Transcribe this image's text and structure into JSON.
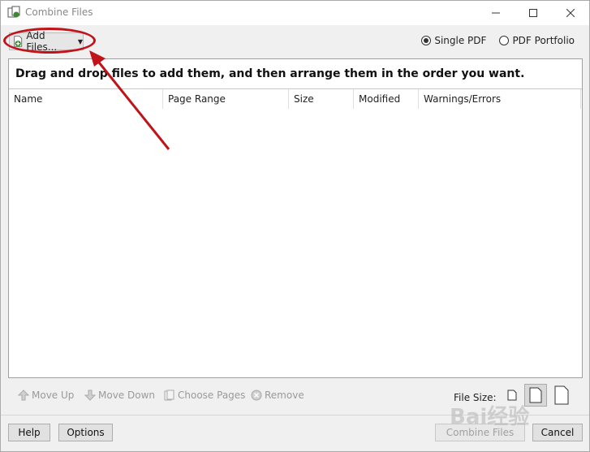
{
  "window": {
    "title": "Combine Files"
  },
  "toolbar": {
    "add_files_label": "Add Files...",
    "radio_single": "Single PDF",
    "radio_portfolio": "PDF Portfolio",
    "selected": "single"
  },
  "panel": {
    "instruction": "Drag and drop files to add them, and then arrange them in the order you want.",
    "columns": [
      "Name",
      "Page Range",
      "Size",
      "Modified",
      "Warnings/Errors"
    ]
  },
  "actions": {
    "move_up": "Move Up",
    "move_down": "Move Down",
    "choose_pages": "Choose Pages",
    "remove": "Remove",
    "file_size_label": "File Size:"
  },
  "buttons": {
    "help": "Help",
    "options": "Options",
    "combine": "Combine Files",
    "cancel": "Cancel"
  },
  "colors": {
    "annotation_red": "#c0141a"
  }
}
